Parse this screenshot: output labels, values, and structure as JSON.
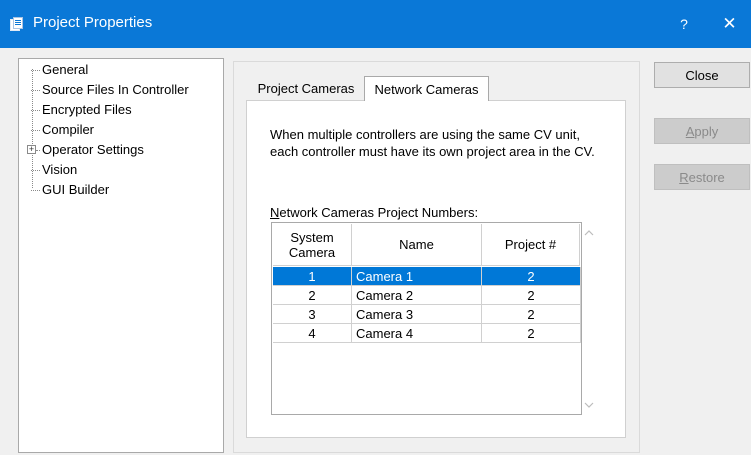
{
  "window": {
    "title": "Project Properties",
    "help": "?",
    "close": "✕"
  },
  "tree": {
    "items": [
      {
        "label": "General",
        "expandable": false
      },
      {
        "label": "Source Files In Controller",
        "expandable": false
      },
      {
        "label": "Encrypted Files",
        "expandable": false
      },
      {
        "label": "Compiler",
        "expandable": false
      },
      {
        "label": "Operator Settings",
        "expandable": true,
        "expander": "+"
      },
      {
        "label": "Vision",
        "expandable": false
      },
      {
        "label": "GUI Builder",
        "expandable": false
      }
    ]
  },
  "tabs": [
    {
      "label": "Project Cameras",
      "active": false
    },
    {
      "label": "Network Cameras",
      "active": true
    }
  ],
  "panel": {
    "description": "When multiple controllers are using the same CV unit, each controller must have its own project area in the CV.",
    "grid_label_access": "N",
    "grid_label_rest": "etwork Cameras Project Numbers:"
  },
  "grid": {
    "columns": [
      "System Camera",
      "Name",
      "Project #"
    ],
    "rows": [
      {
        "camera": "1",
        "name": "Camera 1",
        "project": "2",
        "selected": true
      },
      {
        "camera": "2",
        "name": "Camera 2",
        "project": "2",
        "selected": false
      },
      {
        "camera": "3",
        "name": "Camera 3",
        "project": "2",
        "selected": false
      },
      {
        "camera": "4",
        "name": "Camera 4",
        "project": "2",
        "selected": false
      }
    ],
    "scroll_up": "^",
    "scroll_down": "v"
  },
  "buttons": {
    "close": {
      "label": "Close",
      "enabled": true
    },
    "apply": {
      "label": "Apply",
      "access_key": "A",
      "rest": "pply",
      "enabled": false
    },
    "restore": {
      "label": "Restore",
      "access_key": "R",
      "rest": "estore",
      "enabled": false
    }
  },
  "colors": {
    "titlebar": "#0a78d7",
    "selection": "#0078d7",
    "disabled_text": "#8a8a8a"
  }
}
